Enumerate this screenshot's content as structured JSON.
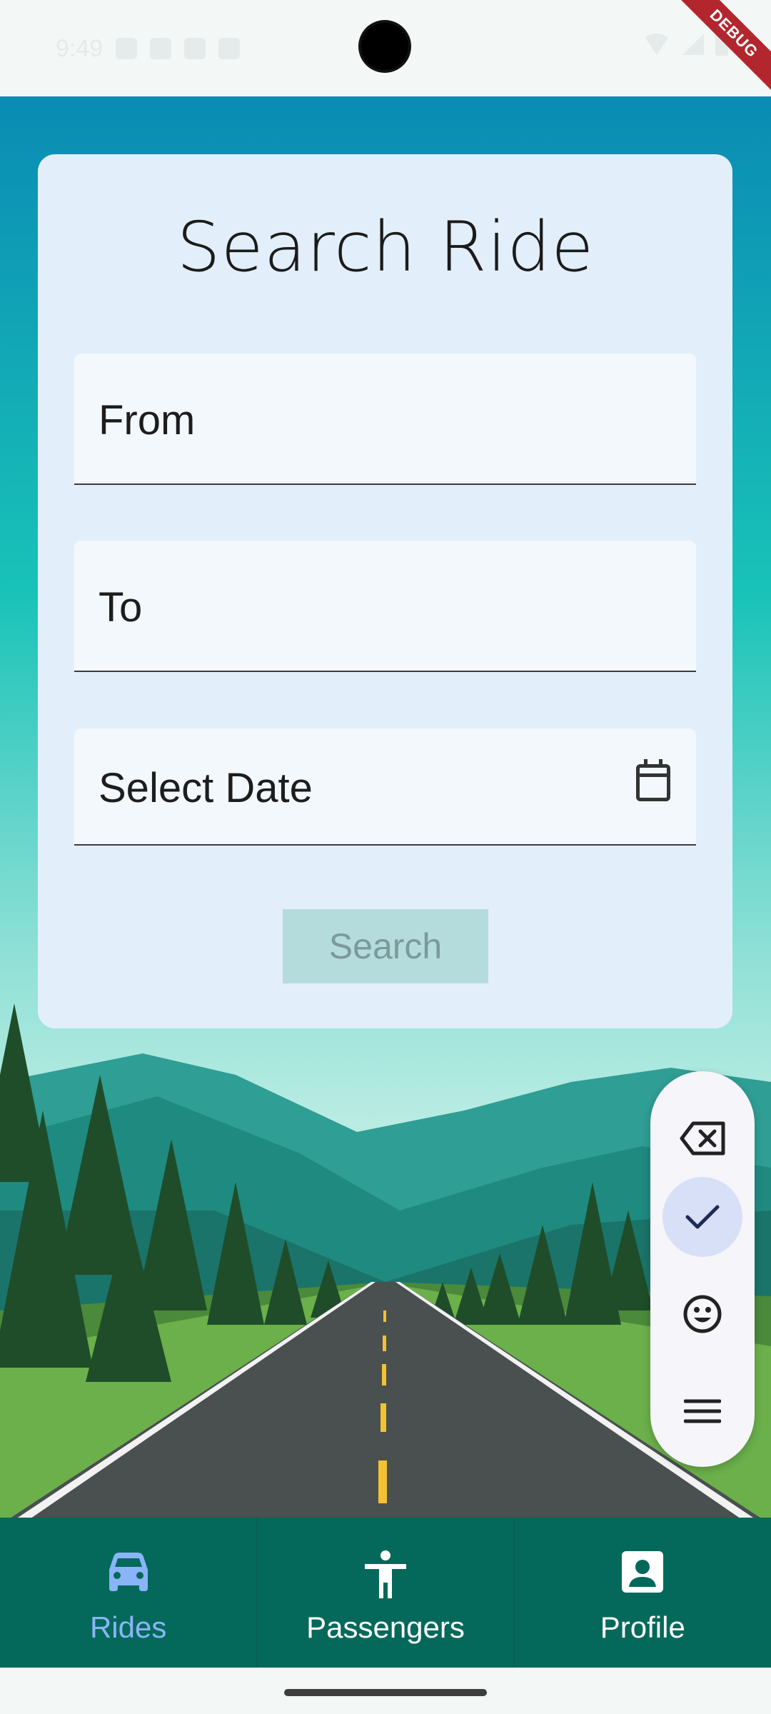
{
  "status_bar": {
    "time": "9:49"
  },
  "debug_banner": "DEBUG",
  "form": {
    "title": "Search Ride",
    "from_label": "From",
    "to_label": "To",
    "date_label": "Select Date",
    "search_label": "Search"
  },
  "floating_toolbar": {
    "items": [
      "backspace-icon",
      "check-icon",
      "emoji-icon",
      "menu-icon"
    ],
    "active_index": 1
  },
  "bottom_nav": {
    "items": [
      {
        "label": "Rides",
        "icon": "car-icon",
        "active": true
      },
      {
        "label": "Passengers",
        "icon": "person-icon",
        "active": false
      },
      {
        "label": "Profile",
        "icon": "profile-icon",
        "active": false
      }
    ]
  },
  "colors": {
    "nav_bg": "#04695a",
    "active_tab": "#8ab4f8",
    "card_bg": "#e2effb",
    "search_button": "#b5dcdc"
  }
}
